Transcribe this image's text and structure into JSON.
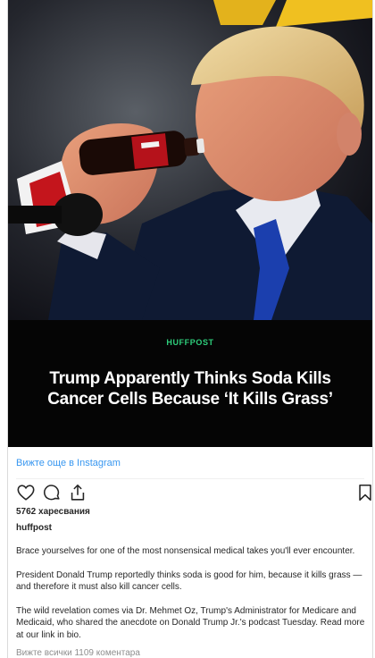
{
  "post": {
    "source_label": "HUFFPOST",
    "headline": "Trump Apparently Thinks Soda Kills Cancer Cells Because ‘It Kills Grass’",
    "view_more_link": "Вижте още в Instagram",
    "likes_text": "5762 харесвания",
    "author": "huffpost",
    "caption": [
      "Brace yourselves for one of the most nonsensical medical takes you'll ever encounter.",
      "President Donald Trump reportedly thinks soda is good for him, because it kills grass — and therefore it must also kill cancer cells.",
      "The wild revelation comes via Dr. Mehmet Oz, Trump's Administrator for Medicare and Medicaid, who shared the anecdote on Donald Trump Jr.'s podcast Tuesday. Read more at our link in bio."
    ],
    "comments_link": "Вижте всички 1109 коментара"
  },
  "icons": {
    "like": "heart-icon",
    "comment": "comment-icon",
    "share": "share-icon",
    "save": "bookmark-icon"
  },
  "colors": {
    "link": "#3897f0",
    "brand_label": "#2ecf7c",
    "text": "#262626",
    "muted": "#8e8e8e"
  }
}
